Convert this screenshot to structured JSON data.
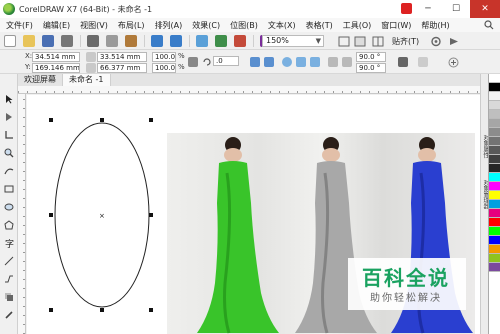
{
  "window": {
    "title": "CorelDRAW X7 (64-Bit) - 未命名 -1",
    "minimize": "─",
    "maximize": "☐",
    "close": "✕"
  },
  "menu": {
    "items": [
      "文件(F)",
      "编辑(E)",
      "视图(V)",
      "布局(L)",
      "排列(A)",
      "效果(C)",
      "位图(B)",
      "文本(X)",
      "表格(T)",
      "工具(O)",
      "窗口(W)",
      "帮助(H)"
    ]
  },
  "toolbar": {
    "zoom_value": "150%",
    "snap_label": "贴齐(T)"
  },
  "property_bar": {
    "x_label": "X:",
    "x_value": "34.514 mm",
    "y_label": "Y:",
    "y_value": "169.146 mm",
    "width_value": "33.514 mm",
    "height_value": "66.377 mm",
    "scale_w": "100.0",
    "scale_h": "100.0",
    "percent": "%",
    "rotation": ".0",
    "skew_1": "90.0 °",
    "skew_2": "90.0 °"
  },
  "tabs": [
    {
      "label": "欢迎屏幕",
      "active": false
    },
    {
      "label": "未命名 -1",
      "active": true
    }
  ],
  "docker": {
    "labels": [
      "对象属性",
      "对象管理器"
    ]
  },
  "palette": {
    "colors": [
      "#ffffff",
      "#000000",
      "#f2f2f2",
      "#d9d9d9",
      "#bfbfbf",
      "#a6a6a6",
      "#8c8c8c",
      "#737373",
      "#595959",
      "#404040",
      "#262626",
      "#00ffff",
      "#ff00ff",
      "#ffff00",
      "#00a0e0",
      "#e6007e",
      "#ff0000",
      "#00ff00",
      "#0000ff",
      "#f39800",
      "#8fc31f",
      "#7b4a9e"
    ]
  },
  "photo": {
    "dress_colors": [
      "#39c42a",
      "#a8a8a8",
      "#2a3fd0"
    ]
  },
  "watermark": {
    "title": "百科全说",
    "subtitle": "助你轻松解决",
    "color": "#1aa260"
  }
}
